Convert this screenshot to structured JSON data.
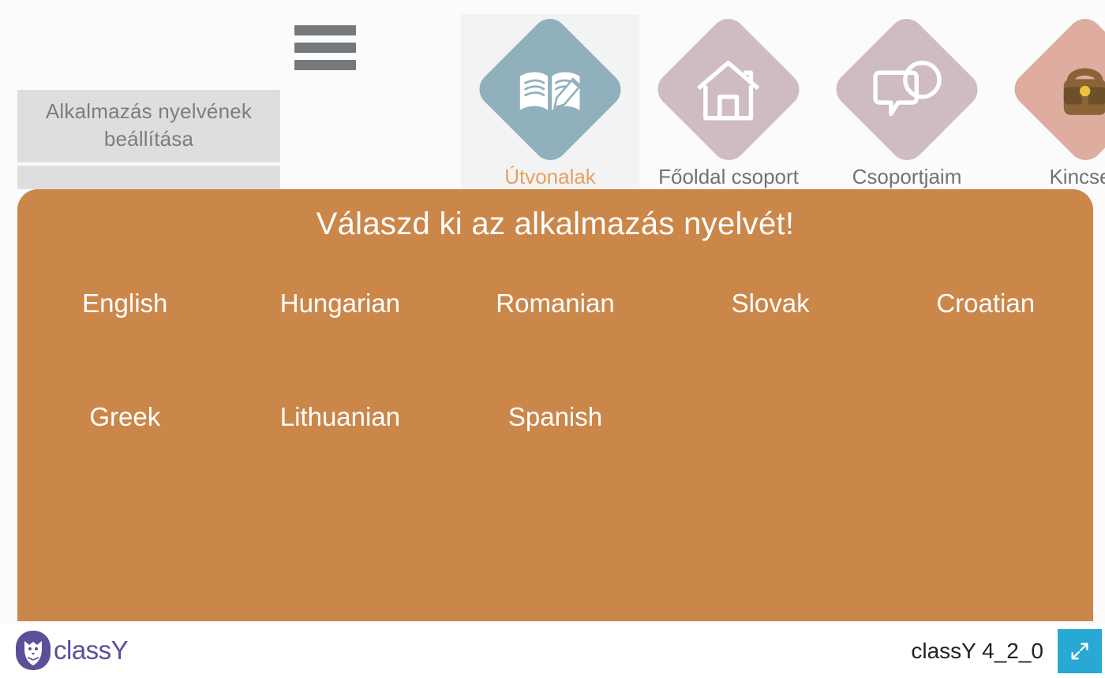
{
  "sidebar": {
    "items": [
      {
        "label": "Alkalmazás nyelvének beállítása",
        "name": "app-language-setting"
      }
    ]
  },
  "menu": {
    "hamburger_name": "hamburger-menu"
  },
  "nav": {
    "tiles": [
      {
        "label": "Útvonalak",
        "icon": "book-pencil-icon",
        "color": "#8fb0bc",
        "active": true
      },
      {
        "label": "Főoldal csoport",
        "icon": "home-icon",
        "color": "#cfbcc0",
        "active": false
      },
      {
        "label": "Csoportjaim",
        "icon": "chat-group-icon",
        "color": "#cfbcc0",
        "active": false
      },
      {
        "label": "Kincses",
        "icon": "backpack-icon",
        "color": "#deada0",
        "active": false
      }
    ]
  },
  "language_dialog": {
    "title": "Válaszd ki az alkalmazás nyelvét!",
    "options": [
      "English",
      "Hungarian",
      "Romanian",
      "Slovak",
      "Croatian",
      "Greek",
      "Lithuanian",
      "Spanish"
    ],
    "background_color": "#cb8749"
  },
  "footer": {
    "brand": "classY",
    "version": "classY 4_2_0",
    "fullscreen_icon": "expand-arrows-icon",
    "fullscreen_color": "#28a8d4"
  }
}
